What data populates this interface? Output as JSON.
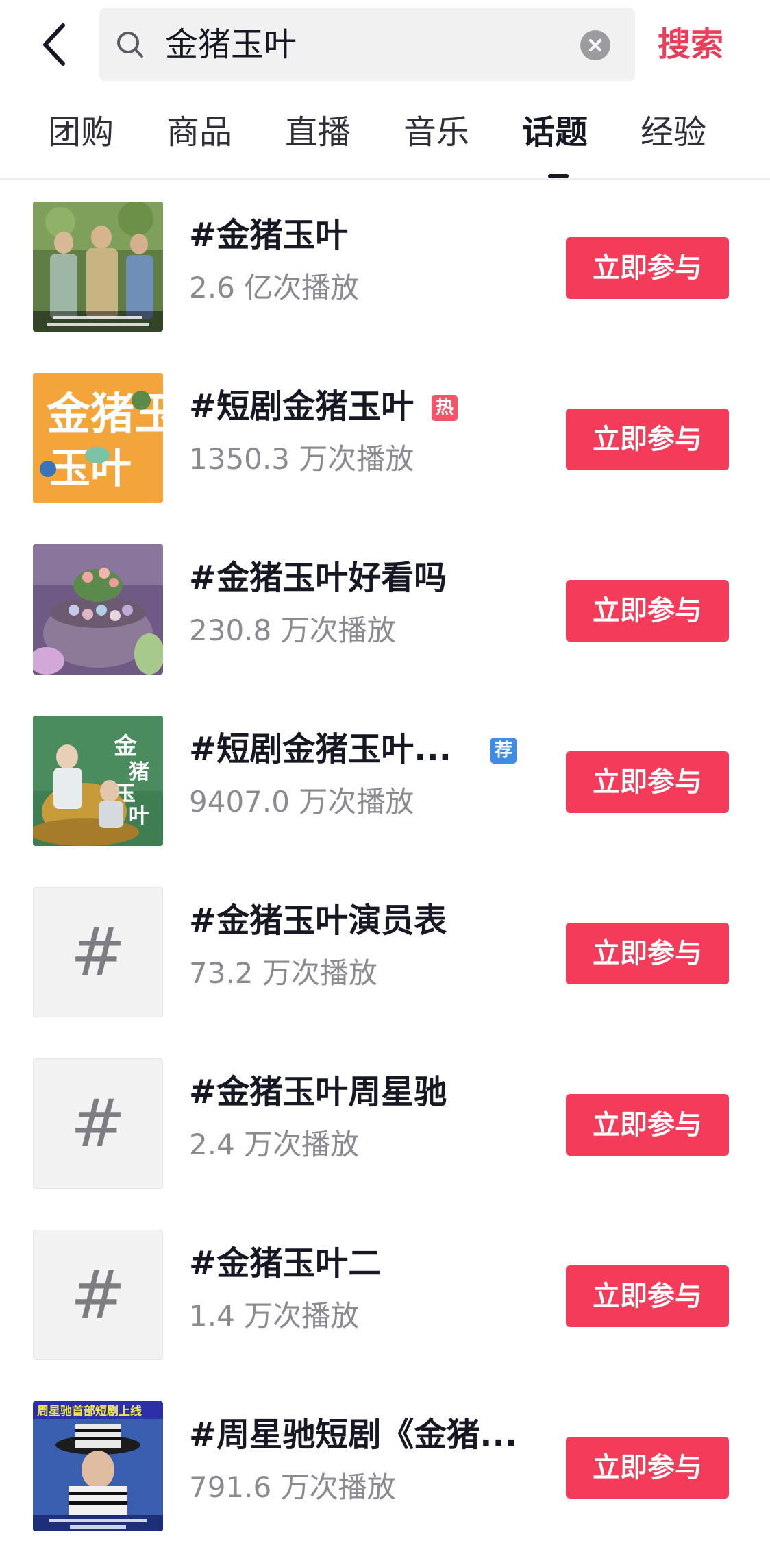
{
  "search": {
    "query": "金猪玉叶",
    "submit_label": "搜索"
  },
  "tabs": [
    {
      "label": "团购"
    },
    {
      "label": "商品"
    },
    {
      "label": "直播"
    },
    {
      "label": "音乐"
    },
    {
      "label": "话题",
      "active": true
    },
    {
      "label": "经验"
    }
  ],
  "topics": [
    {
      "title": "#金猪玉叶",
      "plays": "2.6 亿次播放",
      "button": "立即参与",
      "badge": "",
      "thumb": "photo-three-men"
    },
    {
      "title": "#短剧金猪玉叶",
      "plays": "1350.3 万次播放",
      "button": "立即参与",
      "badge": "热",
      "thumb": "poster-orange"
    },
    {
      "title": "#金猪玉叶好看吗",
      "plays": "230.8 万次播放",
      "button": "立即参与",
      "badge": "",
      "thumb": "photo-succulent"
    },
    {
      "title": "#短剧金猪玉叶...",
      "plays": "9407.0 万次播放",
      "button": "立即参与",
      "badge": "荐",
      "thumb": "poster-green"
    },
    {
      "title": "#金猪玉叶演员表",
      "plays": "73.2 万次播放",
      "button": "立即参与",
      "badge": "",
      "thumb": "hash-placeholder"
    },
    {
      "title": "#金猪玉叶周星驰",
      "plays": "2.4 万次播放",
      "button": "立即参与",
      "badge": "",
      "thumb": "hash-placeholder"
    },
    {
      "title": "#金猪玉叶二",
      "plays": "1.4 万次播放",
      "button": "立即参与",
      "badge": "",
      "thumb": "hash-placeholder"
    },
    {
      "title": "#周星驰短剧《金猪...",
      "plays": "791.6 万次播放",
      "button": "立即参与",
      "badge": "",
      "thumb": "photo-hat"
    }
  ],
  "thumb_texts": {
    "poster_orange": "金猪玉叶",
    "poster_green": "金猪玉叶",
    "banner_hat": "周星驰首部短剧上线"
  },
  "placeholder_glyph": "#",
  "colors": {
    "accent": "#f53b5a",
    "hot_badge": "#f7546a",
    "rec_badge": "#3c8ce8"
  }
}
